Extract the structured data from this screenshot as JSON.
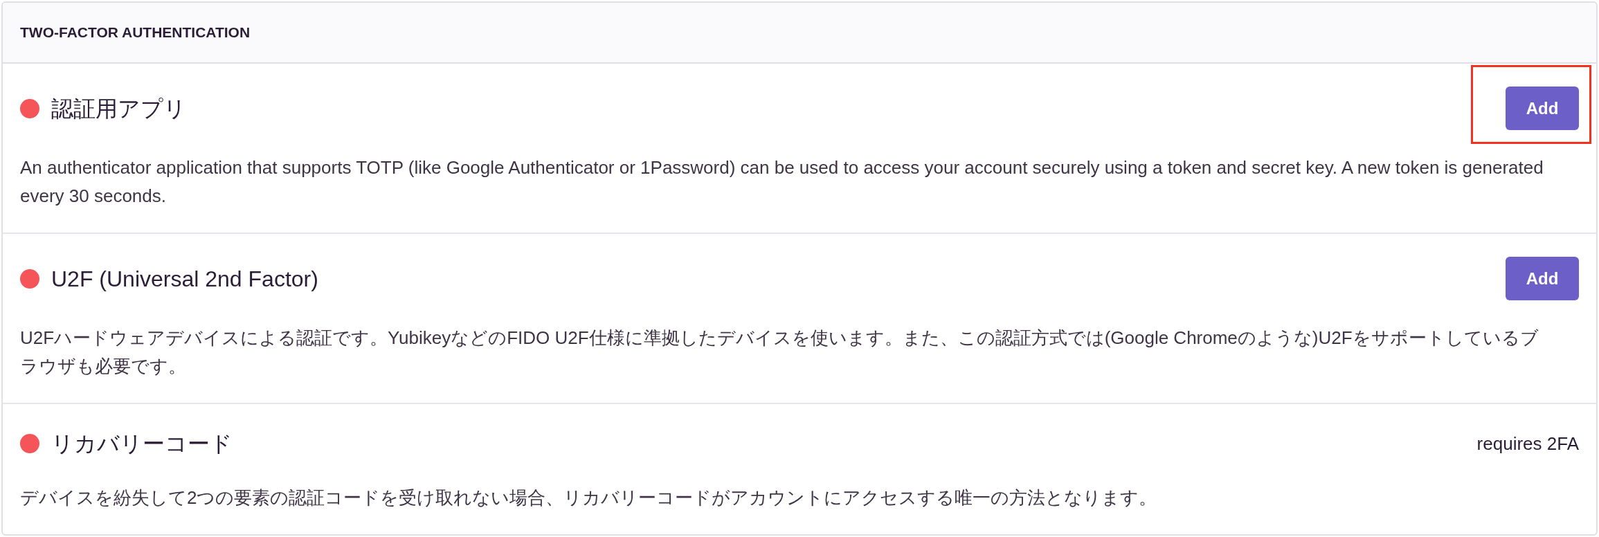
{
  "panel": {
    "title": "TWO-FACTOR AUTHENTICATION"
  },
  "methods": [
    {
      "name": "認証用アプリ",
      "enrolled": false,
      "action": {
        "kind": "button",
        "label": "Add",
        "highlighted": true
      },
      "description": "An authenticator application that supports TOTP (like Google Authenticator or 1Password) can be used to access your account securely using a token and secret key. A new token is generated every 30 seconds."
    },
    {
      "name": "U2F (Universal 2nd Factor)",
      "enrolled": false,
      "action": {
        "kind": "button",
        "label": "Add"
      },
      "description": "U2Fハードウェアデバイスによる認証です。YubikeyなどのFIDO U2F仕様に準拠したデバイスを使います。また、この認証方式では(Google Chromeのような)U2Fをサポートしているブラウザも必要です。"
    },
    {
      "name": "リカバリーコード",
      "enrolled": false,
      "action": {
        "kind": "note",
        "label": "requires 2FA"
      },
      "description": "デバイスを紛失して2つの要素の認証コードを受け取れない場合、リカバリーコードがアカウントにアクセスする唯一の方法となります。"
    }
  ]
}
